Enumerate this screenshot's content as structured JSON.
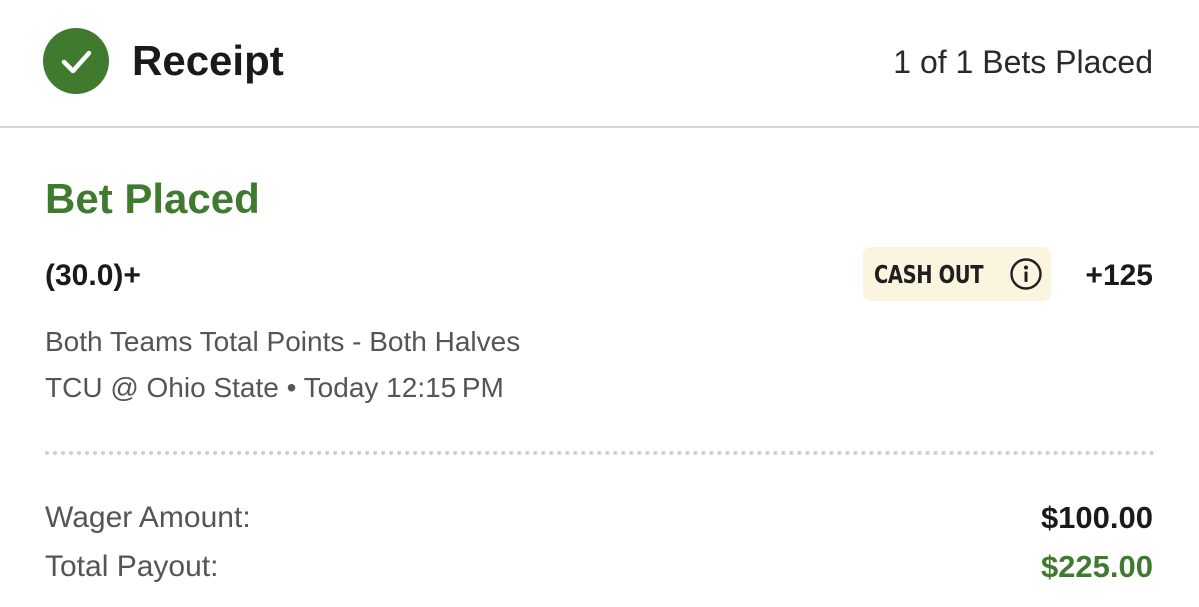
{
  "header": {
    "title": "Receipt",
    "bets_placed": "1 of 1 Bets Placed",
    "icon": "check-circle-icon"
  },
  "bet": {
    "status": "Bet Placed",
    "selection": "(30.0)+",
    "cash_out_label": "CASH OUT",
    "odds": "+125",
    "market": "Both Teams Total Points - Both Halves",
    "event": "TCU @ Ohio State • Today 12:15 PM"
  },
  "summary": {
    "wager_label": "Wager Amount:",
    "wager_value": "$100.00",
    "payout_label": "Total Payout:",
    "payout_value": "$225.00"
  },
  "colors": {
    "accent_green": "#3f7a2f",
    "cashout_bg": "#fbf4df"
  }
}
